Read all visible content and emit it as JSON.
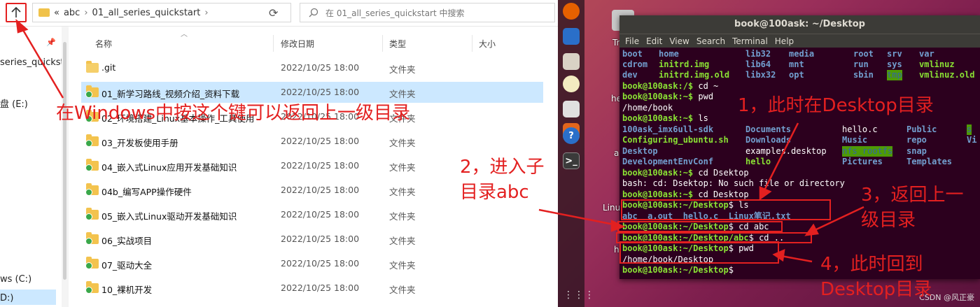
{
  "explorer": {
    "breadcrumb": [
      "«",
      "abc",
      "›",
      "01_all_series_quickstart",
      "›"
    ],
    "search_placeholder": "在 01_all_series_quickstart 中搜索",
    "nav_items": [
      "series_quickst",
      "盘 (E:)",
      "ws (C:)",
      "D:)"
    ],
    "columns": {
      "name": "名称",
      "date": "修改日期",
      "type": "类型",
      "size": "大小"
    },
    "files": [
      {
        "name": ".git",
        "date": "2022/10/25 18:00",
        "type": "文件夹"
      },
      {
        "name": "01_新学习路线_视频介绍_资料下载",
        "date": "2022/10/25 18:00",
        "type": "文件夹"
      },
      {
        "name": "02_环境搭建_Linux基本操作_工具使用",
        "date": "2022/10/25 18:00",
        "type": "文件夹"
      },
      {
        "name": "03_开发板使用手册",
        "date": "2022/10/25 18:00",
        "type": "文件夹"
      },
      {
        "name": "04_嵌入式Linux应用开发基础知识",
        "date": "2022/10/25 18:00",
        "type": "文件夹"
      },
      {
        "name": "04b_编写APP操作硬件",
        "date": "2022/10/25 18:00",
        "type": "文件夹"
      },
      {
        "name": "05_嵌入式Linux驱动开发基础知识",
        "date": "2022/10/25 18:00",
        "type": "文件夹"
      },
      {
        "name": "06_实战项目",
        "date": "2022/10/25 18:00",
        "type": "文件夹"
      },
      {
        "name": "07_驱动大全",
        "date": "2022/10/25 18:00",
        "type": "文件夹"
      },
      {
        "name": "10_裸机开发",
        "date": "2022/10/25 18:00",
        "type": "文件夹"
      }
    ]
  },
  "annotations": {
    "explorer_note": "在Windows中按这个键可以返回上一级目录",
    "note1": "1，此时在Desktop目录",
    "note2_line1": "2，进入子",
    "note2_line2": "目录abc",
    "note3_line1": "3，返回上一",
    "note3_line2": "级目录",
    "note4_line1": "4，此时回到",
    "note4_line2": "Desktop目录"
  },
  "desktop": {
    "labels": [
      "Tr",
      "he",
      "a.",
      "Linux",
      "h"
    ],
    "watermark": "CSDN @风正豪"
  },
  "terminal": {
    "title": "book@100ask: ~/Desktop",
    "menu": [
      "File",
      "Edit",
      "View",
      "Search",
      "Terminal",
      "Help"
    ],
    "ls_root": [
      [
        "boot",
        "home",
        "lib32",
        "media",
        "root",
        "srv",
        "var"
      ],
      [
        "cdrom",
        "initrd.img",
        "lib64",
        "mnt",
        "run",
        "sys",
        "vmlinuz"
      ],
      [
        "dev",
        "initrd.img.old",
        "libx32",
        "opt",
        "sbin",
        "tmp",
        "vmlinuz.old"
      ]
    ],
    "lines": {
      "p_root": "book@100ask:/$",
      "cmd_cd_home": " cd ~",
      "p_home": "book@100ask:~$",
      "cmd_pwd": " pwd",
      "out_home": "/home/book",
      "cmd_ls": " ls",
      "home_ls": [
        [
          "100ask_imx6ull-sdk",
          "Documents",
          "hello.c",
          "Public",
          "s"
        ],
        [
          "Configuring_ubuntu.sh",
          "Downloads",
          "Music",
          "repo",
          "Vi"
        ],
        [
          "Desktop",
          "examples.desktop",
          "nfs_rootfs",
          "snap",
          ""
        ],
        [
          "DevelopmentEnvConf",
          "hello",
          "Pictures",
          "Templates",
          ""
        ]
      ],
      "cmd_cd_dsektop": " cd Dsektop",
      "err": "bash: cd: Dsektop: No such file or directory",
      "cmd_cd_desktop": " cd Desktop",
      "p_desktop": "book@100ask:~/Desktop",
      "dollar": "$",
      "cmd_ls2": " ls",
      "desktop_ls": "abc  a.out  hello.c  Linux笔记.txt",
      "cmd_cd_abc": " cd abc",
      "p_abc": "book@100ask:~/Desktop/abc",
      "cmd_cd_up": " cd ..",
      "cmd_pwd2": " pwd",
      "out_desktop": "/home/book/Desktop"
    }
  }
}
